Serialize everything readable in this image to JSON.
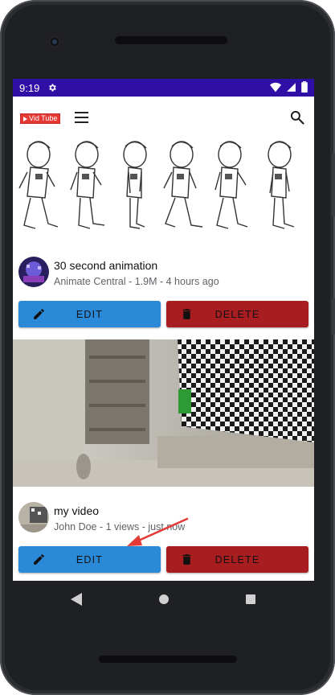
{
  "status_bar": {
    "time": "9:19"
  },
  "app_bar": {
    "logo_text": "Vid Tube",
    "icons": [
      "menu-icon",
      "search-icon"
    ]
  },
  "videos": [
    {
      "title": "30 second animation",
      "subtitle": "Animate Central - 1.9M - 4 hours ago",
      "edit_label": "EDIT",
      "delete_label": "DELETE"
    },
    {
      "title": "my video",
      "subtitle": "John Doe - 1 views - just now",
      "edit_label": "EDIT",
      "delete_label": "DELETE"
    }
  ],
  "colors": {
    "status_bar": "#2f0fa6",
    "edit_button": "#2b8ad8",
    "delete_button": "#a81d20",
    "annotation_arrow": "#e53935",
    "logo": "#e53935"
  }
}
